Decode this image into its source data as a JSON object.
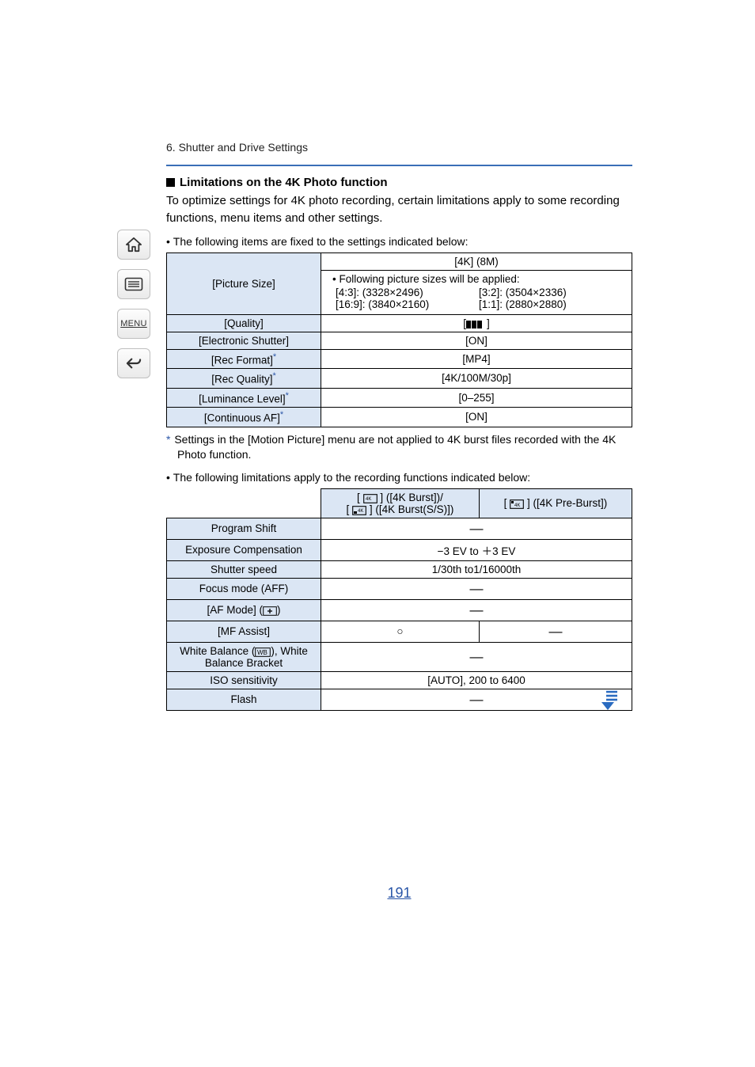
{
  "breadcrumb": "6. Shutter and Drive Settings",
  "section_title": "Limitations on the 4K Photo function",
  "intro": "To optimize settings for 4K photo recording, certain limitations apply to some recording functions, menu items and other settings.",
  "bullet1": "The following items are fixed to the settings indicated below:",
  "table1": {
    "rows": [
      {
        "label": "[Picture Size]",
        "top": "[4K] (8M)",
        "applied_intro": "• Following picture sizes will be applied:",
        "sizes": {
          "a": "[4:3]: (3328×2496)",
          "b": "[3:2]: (3504×2336)",
          "c": "[16:9]: (3840×2160)",
          "d": "[1:1]: (2880×2880)"
        }
      },
      {
        "label": "[Quality]",
        "val_icon": "fine-plus-raw"
      },
      {
        "label": "[Electronic Shutter]",
        "val": "[ON]"
      },
      {
        "label": "[Rec Format]",
        "star": true,
        "val": "[MP4]"
      },
      {
        "label": "[Rec Quality]",
        "star": true,
        "val": "[4K/100M/30p]"
      },
      {
        "label": "[Luminance Level]",
        "star": true,
        "val": "[0–255]"
      },
      {
        "label": "[Continuous AF]",
        "star": true,
        "val": "[ON]"
      }
    ]
  },
  "footnote": "Settings in the [Motion Picture] menu are not applied to 4K burst files recorded with the 4K Photo function.",
  "bullet2": "The following limitations apply to the recording functions indicated below:",
  "table2": {
    "head_a_line1": "] ([4K Burst])/",
    "head_a_line2": "] ([4K Burst(S/S)])",
    "head_b": "] ([4K Pre-Burst])",
    "rows": [
      {
        "label": "Program Shift",
        "span": true,
        "val": "—"
      },
      {
        "label": "Exposure Compensation",
        "span": true,
        "val": "−3 EV to ＋3 EV"
      },
      {
        "label": "Shutter speed",
        "span": true,
        "val": "1/30th to1/16000th"
      },
      {
        "label": "Focus mode (AFF)",
        "span": true,
        "val": "—"
      },
      {
        "label": "[AF Mode] (",
        "label_suffix": ")",
        "has_icon": true,
        "span": true,
        "val": "—"
      },
      {
        "label": "[MF Assist]",
        "a": "○",
        "b": "—"
      },
      {
        "label": "White Balance (",
        "label_suffix": "), White Balance Bracket",
        "has_wb_icon": true,
        "span": true,
        "val": "—"
      },
      {
        "label": "ISO sensitivity",
        "span": true,
        "val": "[AUTO], 200 to 6400"
      },
      {
        "label": "Flash",
        "span": true,
        "val": "—"
      }
    ]
  },
  "page_number": "191"
}
